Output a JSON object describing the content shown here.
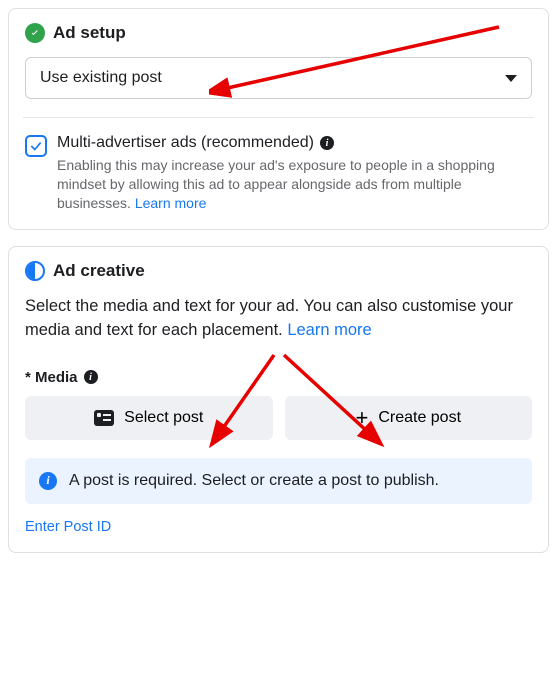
{
  "adSetup": {
    "title": "Ad setup",
    "dropdown": {
      "value": "Use existing post"
    },
    "multiAdvertiser": {
      "label": "Multi-advertiser ads (recommended)",
      "desc": "Enabling this may increase your ad's exposure to people in a shopping mindset by allowing this ad to appear alongside ads from multiple businesses. ",
      "learnMore": "Learn more"
    }
  },
  "adCreative": {
    "title": "Ad creative",
    "desc": "Select the media and text for your ad. You can also customise your media and text for each placement. ",
    "learnMore": "Learn more",
    "mediaLabel": "* Media",
    "selectPost": "Select post",
    "createPost": "Create post",
    "notice": "A post is required. Select or create a post to publish.",
    "enterPostId": "Enter Post ID"
  }
}
